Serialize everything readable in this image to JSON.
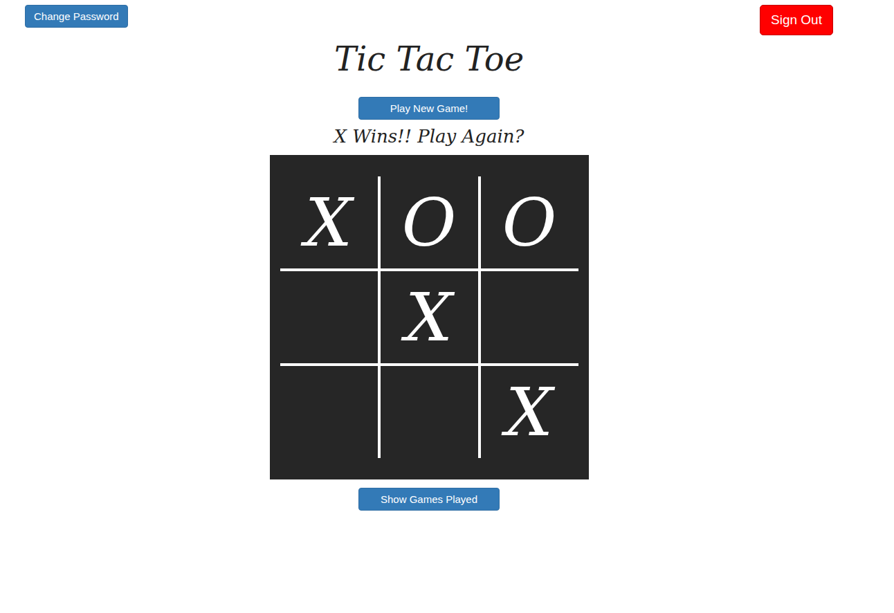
{
  "header": {
    "change_password": "Change Password",
    "sign_out": "Sign Out"
  },
  "title": "Tic Tac Toe",
  "buttons": {
    "new_game": "Play New Game!",
    "show_games": "Show Games Played"
  },
  "status": "X Wins!! Play Again?",
  "board": {
    "cells": [
      {
        "mark": "X"
      },
      {
        "mark": "O"
      },
      {
        "mark": "O"
      },
      {
        "mark": ""
      },
      {
        "mark": "X"
      },
      {
        "mark": ""
      },
      {
        "mark": ""
      },
      {
        "mark": ""
      },
      {
        "mark": "X"
      }
    ]
  }
}
